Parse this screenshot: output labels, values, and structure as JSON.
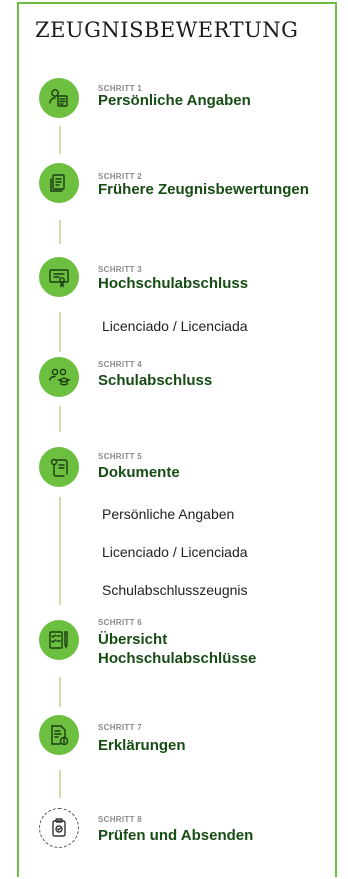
{
  "app": {
    "title": "ZEUGNISBEWERTUNG"
  },
  "colors": {
    "accent": "#6dbf3f",
    "title_text": "#174d14",
    "connector": "#c4e2a8"
  },
  "steps": [
    {
      "kicker": "SCHRITT 1",
      "title": "Persönliche Angaben",
      "icon": "person-form-icon",
      "substeps": []
    },
    {
      "kicker": "SCHRITT 2",
      "title": "Frühere Zeugnisbewertungen",
      "icon": "documents-icon",
      "substeps": []
    },
    {
      "kicker": "SCHRITT 3",
      "title": "Hochschulabschluss",
      "icon": "certificate-icon",
      "substeps": [
        "Licenciado / Licenciada"
      ]
    },
    {
      "kicker": "SCHRITT 4",
      "title": "Schulabschluss",
      "icon": "students-icon",
      "substeps": []
    },
    {
      "kicker": "SCHRITT 5",
      "title": "Dokumente",
      "icon": "scroll-icon",
      "substeps": [
        "Persönliche Angaben",
        "Licenciado / Licenciada",
        "Schulabschlusszeugnis"
      ]
    },
    {
      "kicker": "SCHRITT 6",
      "title": "Übersicht",
      "title_line2": "Hochschulabschlüsse",
      "icon": "checklist-icon",
      "substeps": []
    },
    {
      "kicker": "SCHRITT 7",
      "title": "Erklärungen",
      "icon": "document-info-icon",
      "substeps": []
    },
    {
      "kicker": "SCHRITT 8",
      "title": "Prüfen und Absenden",
      "icon": "clipboard-check-icon",
      "substeps": []
    }
  ]
}
